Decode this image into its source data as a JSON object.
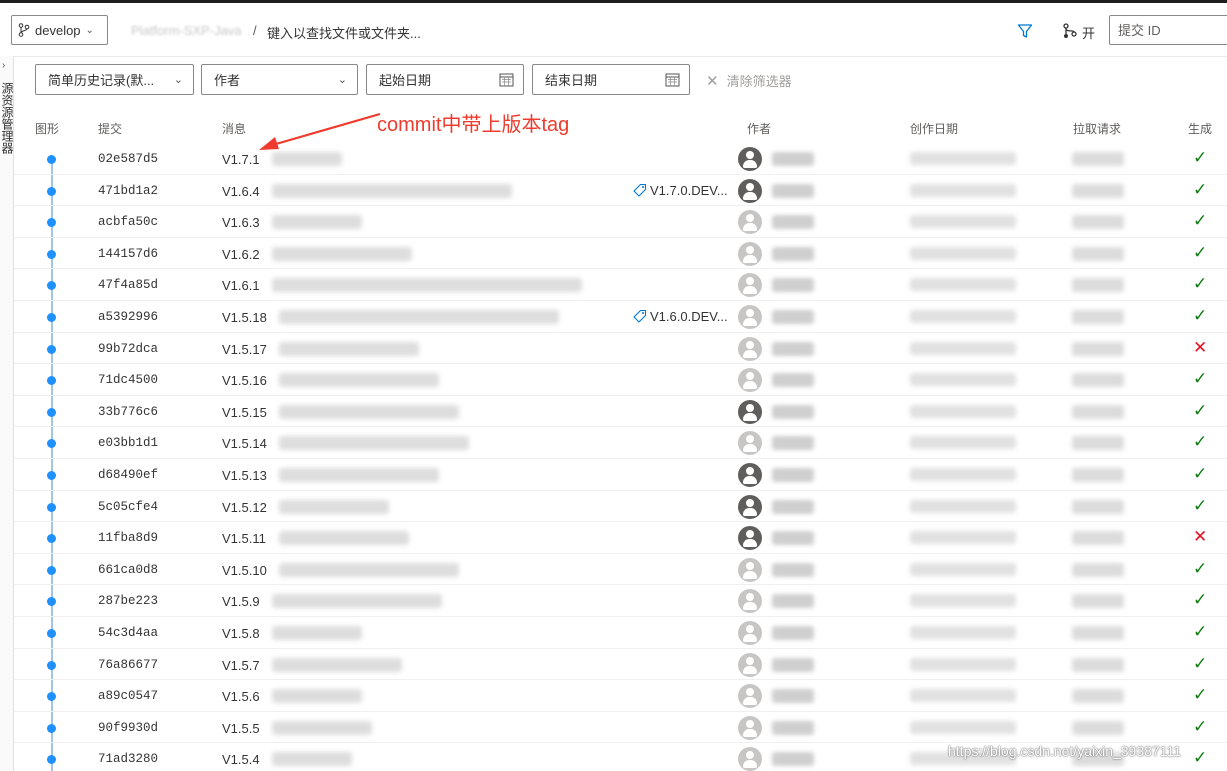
{
  "header": {
    "branch": "develop",
    "repo_name": "Platform-SXP-Java",
    "path_separator": "/",
    "path_placeholder": "键入以查找文件或文件夹...",
    "open_label": "开",
    "commit_id_placeholder": "提交 ID"
  },
  "sidebar": {
    "label": "源资源管理器"
  },
  "filters": {
    "history_mode": "简单历史记录(默...",
    "author": "作者",
    "start_date": "起始日期",
    "end_date": "结束日期",
    "clear": "清除筛选器"
  },
  "columns": {
    "graph": "图形",
    "commit": "提交",
    "message": "消息",
    "author": "作者",
    "date": "创作日期",
    "pr": "拉取请求",
    "build": "生成"
  },
  "annotation": "commit中带上版本tag",
  "rows": [
    {
      "hash": "02e587d5",
      "ver": "V1.7.1",
      "tag": "",
      "avatar": "dark",
      "build": "ok"
    },
    {
      "hash": "471bd1a2",
      "ver": "V1.6.4",
      "tag": "V1.7.0.DEV...",
      "avatar": "dark",
      "build": "ok"
    },
    {
      "hash": "acbfa50c",
      "ver": "V1.6.3",
      "tag": "",
      "avatar": "light",
      "build": "ok"
    },
    {
      "hash": "144157d6",
      "ver": "V1.6.2",
      "tag": "",
      "avatar": "light",
      "build": "ok"
    },
    {
      "hash": "47f4a85d",
      "ver": "V1.6.1",
      "tag": "",
      "avatar": "light",
      "build": "ok"
    },
    {
      "hash": "a5392996",
      "ver": "V1.5.18",
      "tag": "V1.6.0.DEV...",
      "avatar": "light",
      "build": "ok"
    },
    {
      "hash": "99b72dca",
      "ver": "V1.5.17",
      "tag": "",
      "avatar": "light",
      "build": "fail"
    },
    {
      "hash": "71dc4500",
      "ver": "V1.5.16",
      "tag": "",
      "avatar": "light",
      "build": "ok"
    },
    {
      "hash": "33b776c6",
      "ver": "V1.5.15",
      "tag": "",
      "avatar": "dark",
      "build": "ok"
    },
    {
      "hash": "e03bb1d1",
      "ver": "V1.5.14",
      "tag": "",
      "avatar": "light",
      "build": "ok"
    },
    {
      "hash": "d68490ef",
      "ver": "V1.5.13",
      "tag": "",
      "avatar": "dark",
      "build": "ok"
    },
    {
      "hash": "5c05cfe4",
      "ver": "V1.5.12",
      "tag": "",
      "avatar": "dark",
      "build": "ok"
    },
    {
      "hash": "11fba8d9",
      "ver": "V1.5.11",
      "tag": "",
      "avatar": "dark",
      "build": "fail"
    },
    {
      "hash": "661ca0d8",
      "ver": "V1.5.10",
      "tag": "",
      "avatar": "light",
      "build": "ok"
    },
    {
      "hash": "287be223",
      "ver": "V1.5.9",
      "tag": "",
      "avatar": "light",
      "build": "ok"
    },
    {
      "hash": "54c3d4aa",
      "ver": "V1.5.8",
      "tag": "",
      "avatar": "light",
      "build": "ok"
    },
    {
      "hash": "76a86677",
      "ver": "V1.5.7",
      "tag": "",
      "avatar": "light",
      "build": "ok"
    },
    {
      "hash": "a89c0547",
      "ver": "V1.5.6",
      "tag": "",
      "avatar": "light",
      "build": "ok"
    },
    {
      "hash": "90f9930d",
      "ver": "V1.5.5",
      "tag": "",
      "avatar": "light",
      "build": "ok"
    },
    {
      "hash": "71ad3280",
      "ver": "V1.5.4",
      "tag": "",
      "avatar": "light",
      "build": "ok"
    }
  ],
  "watermark": "https://blog.csdn.net/yaixin_39387111",
  "colors": {
    "accent": "#1e90ff",
    "success": "#107c10",
    "failure": "#e81123",
    "annotation": "#ef3b2d"
  }
}
